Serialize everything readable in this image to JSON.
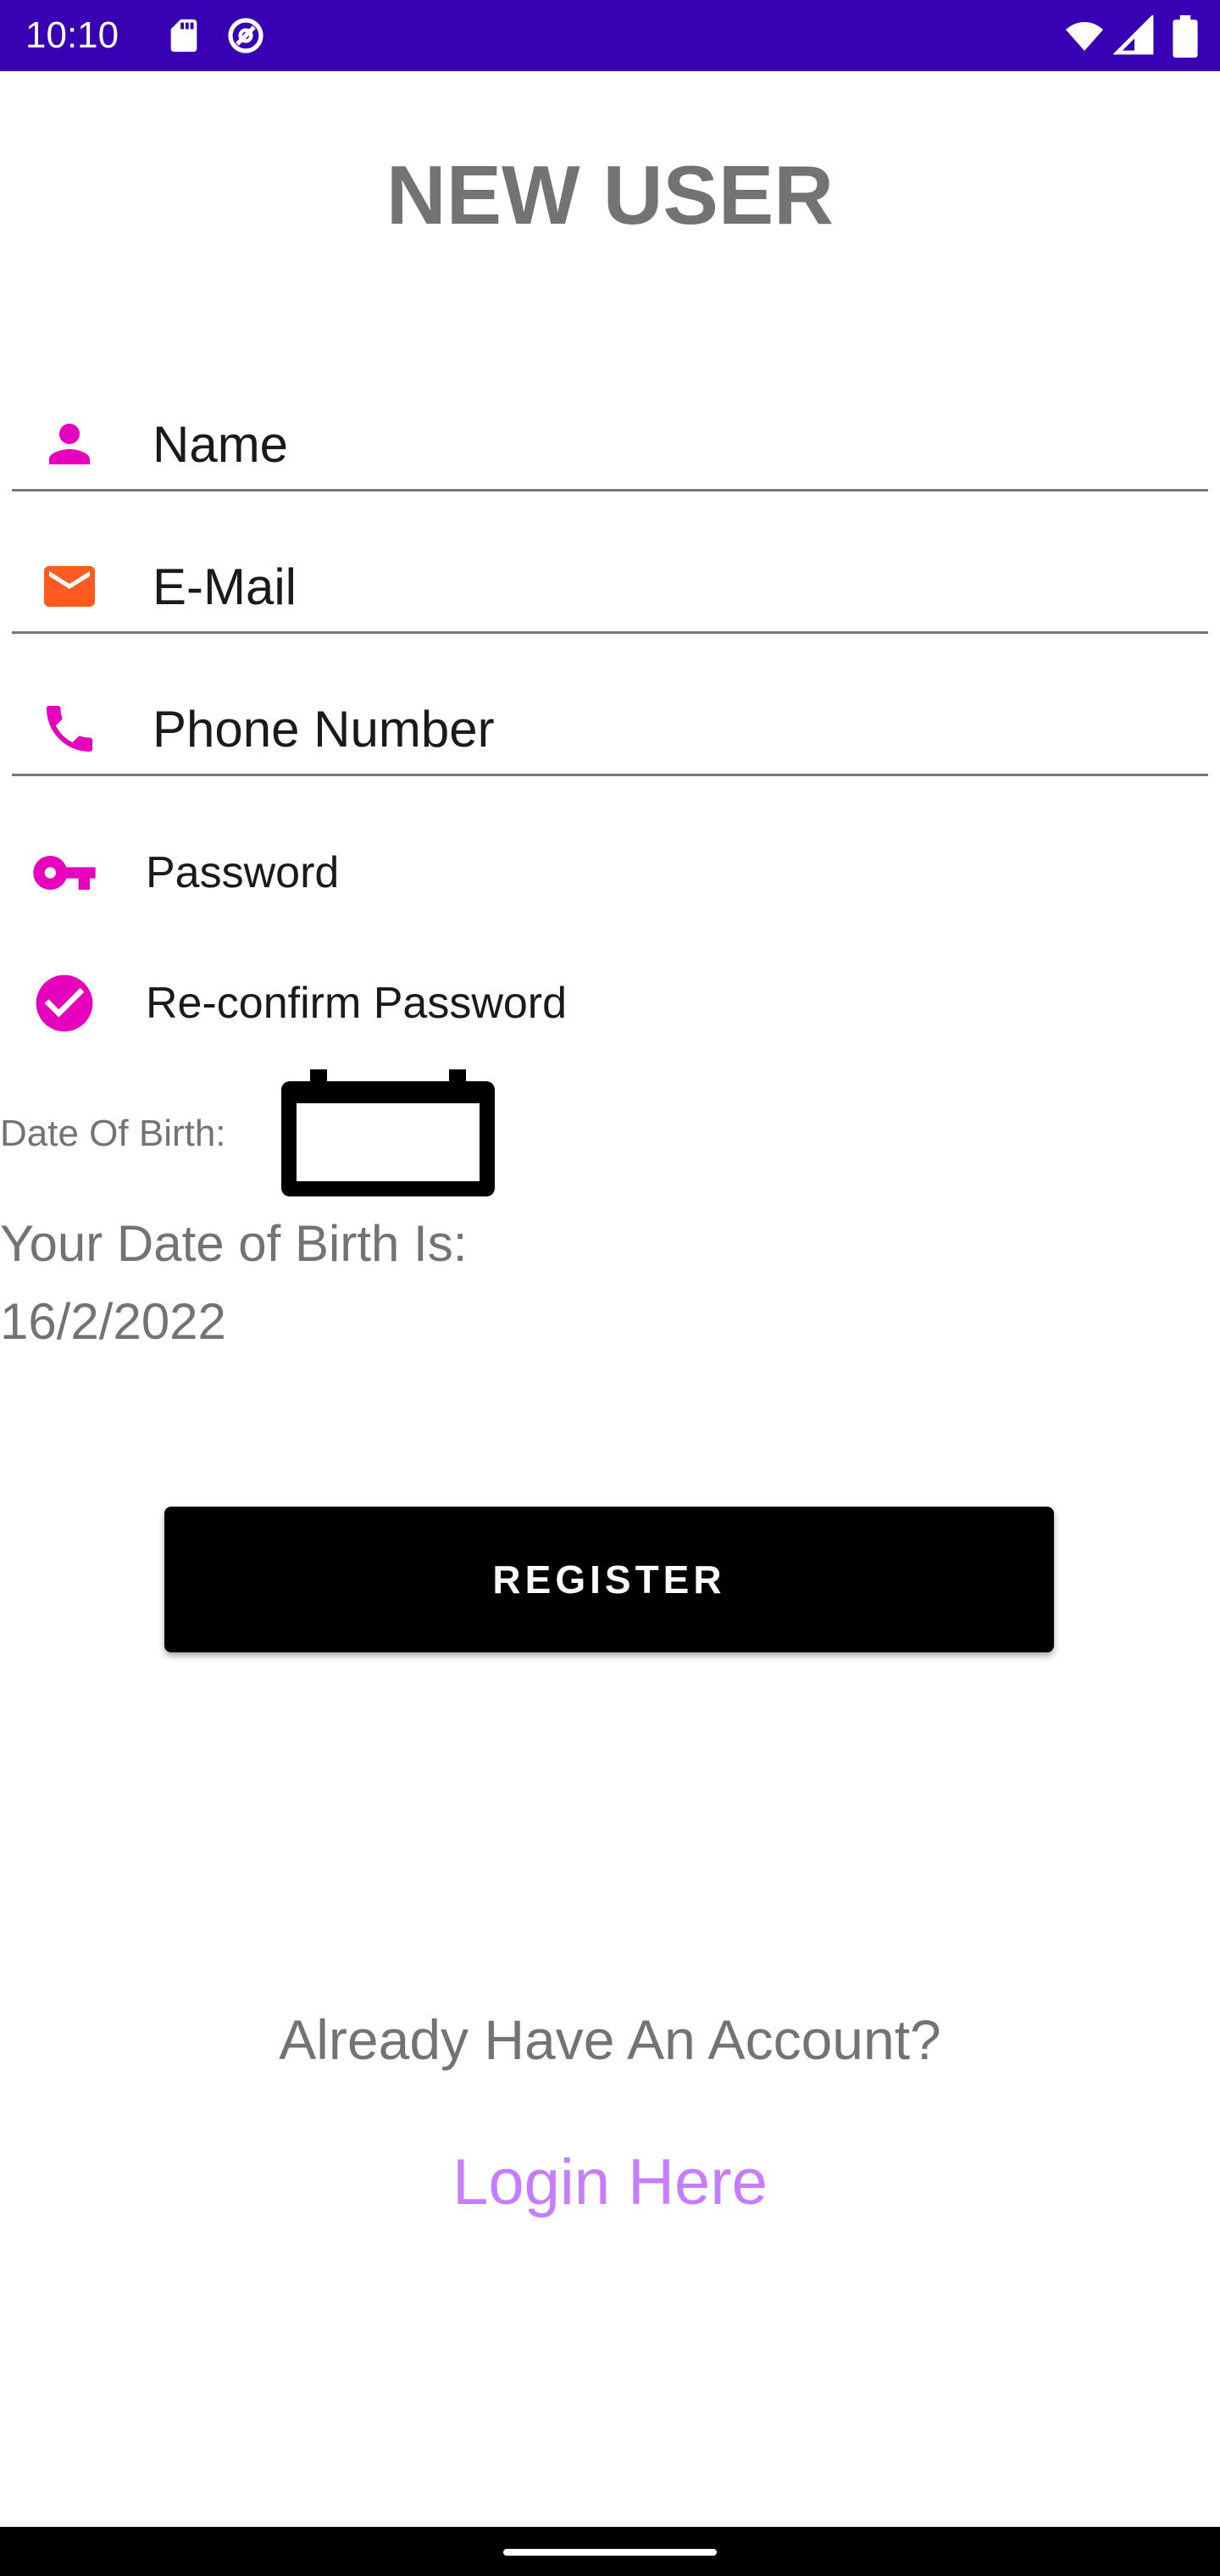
{
  "status_bar": {
    "time": "10:10",
    "left_icons": [
      "sd-card-icon",
      "no-disturb-icon"
    ],
    "right_icons": [
      "wifi-icon",
      "signal-icon",
      "battery-icon"
    ]
  },
  "title": "NEW USER",
  "form": {
    "name": {
      "value": "Name",
      "icon": "person-icon",
      "icon_color": "#E600BE"
    },
    "email": {
      "value": "E-Mail",
      "icon": "mail-icon",
      "icon_color": "#FF5A1F"
    },
    "phone": {
      "value": "Phone Number",
      "icon": "phone-icon",
      "icon_color": "#E600BE"
    },
    "password": {
      "value": "Password",
      "icon": "key-icon",
      "icon_color": "#E600BE"
    },
    "confirm_password": {
      "value": "Re-confirm Password",
      "icon": "check-circle-icon",
      "icon_color": "#E600BE"
    }
  },
  "dob": {
    "label": "Date Of Birth:",
    "icon": "calendar-icon",
    "result_label": "Your Date of Birth Is:",
    "result_value": "16/2/2022"
  },
  "register": {
    "label": "REGISTER"
  },
  "account": {
    "prompt": "Already Have An Account?",
    "login_label": "Login Here",
    "login_color": "#C77DFF"
  },
  "colors": {
    "status_bar": "#3700B3",
    "title_text": "#737373",
    "button": "#000000"
  }
}
